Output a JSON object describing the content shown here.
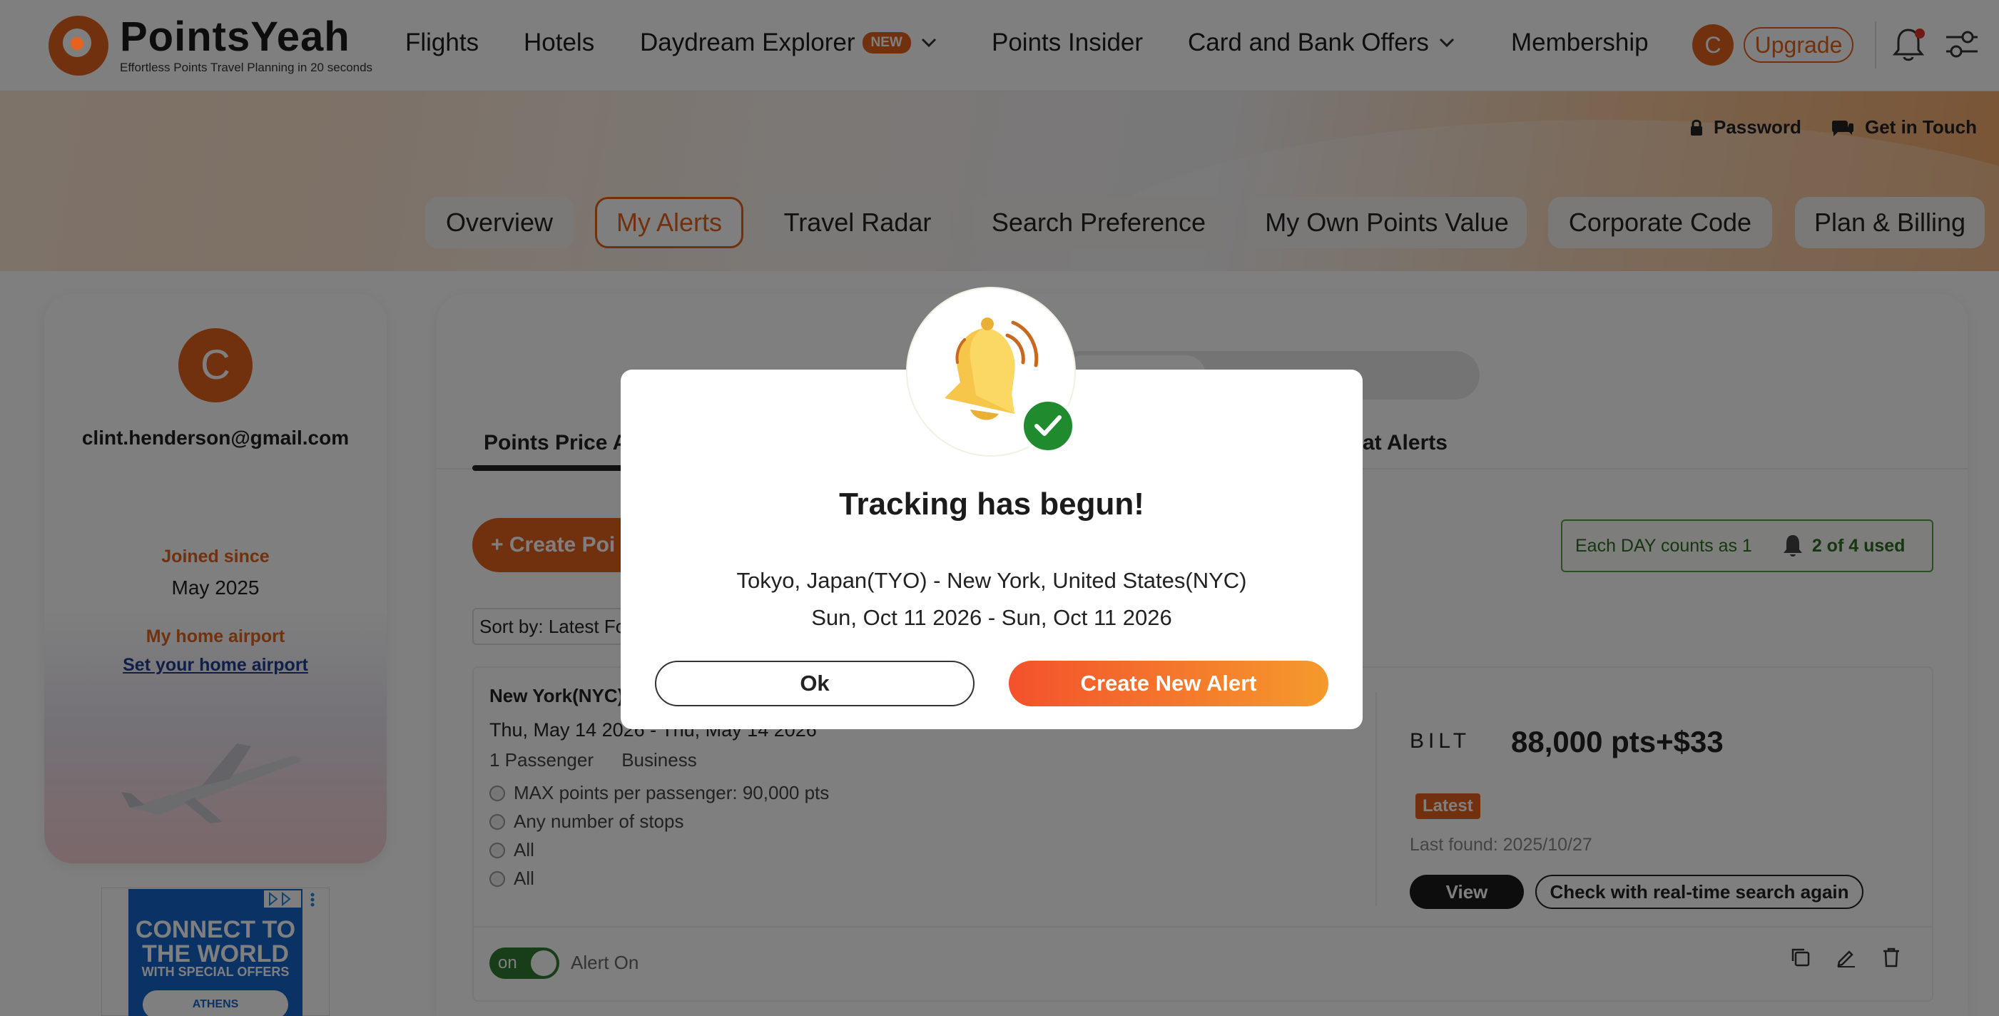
{
  "brand": {
    "name": "PointsYeah",
    "tagline": "Effortless Points Travel Planning in 20 seconds"
  },
  "nav": {
    "items": [
      "Flights",
      "Hotels",
      "Daydream Explorer",
      "Points Insider",
      "Card and Bank Offers",
      "Membership"
    ],
    "new_badge": "NEW",
    "avatar_letter": "C",
    "upgrade": "Upgrade"
  },
  "utility": {
    "password": "Password",
    "contact": "Get in Touch"
  },
  "tabs": [
    "Overview",
    "My Alerts",
    "Travel Radar",
    "Search Preference",
    "My Own Points Value",
    "Corporate Code",
    "Plan & Billing"
  ],
  "profile": {
    "avatar_letter": "C",
    "email": "clint.henderson@gmail.com",
    "joined_label": "Joined since",
    "joined_value": "May 2025",
    "home_label": "My home airport",
    "home_link": "Set your home airport"
  },
  "ad": {
    "title": "CONNECT TO THE WORLD",
    "subtitle": "WITH SPECIAL OFFERS",
    "cta": "ATHENS"
  },
  "alerts": {
    "subtabs": [
      "Points Price A",
      "at Alerts"
    ],
    "create_button": "+ Create Poi",
    "quota_text": "Each DAY counts as 1",
    "quota_used": "2 of 4 used",
    "sort_label": "Sort by: Latest Fo",
    "card": {
      "route": "New York(NYC)",
      "dates": "Thu, May 14 2026 - Thu, May 14 2026",
      "passengers": "1 Passenger",
      "cabin": "Business",
      "criteria": [
        "MAX points per passenger: 90,000 pts",
        "Any number of stops",
        "All",
        "All"
      ],
      "program": "BILT",
      "price": "88,000 pts+$33",
      "latest_badge": "Latest",
      "last_found": "Last found: 2025/10/27",
      "view_button": "View",
      "check_button": "Check with real-time search again",
      "switch_label": "on",
      "alert_status": "Alert On"
    }
  },
  "modal": {
    "title": "Tracking has begun!",
    "route": "Tokyo, Japan(TYO) - New York, United States(NYC)",
    "dates": "Sun, Oct 11 2026 - Sun, Oct 11 2026",
    "ok_button": "Ok",
    "create_button": "Create New Alert"
  },
  "colors": {
    "accent": "#e5631c",
    "success": "#1f8a2e",
    "modal_gradient_start": "#f4512c",
    "modal_gradient_end": "#f59a2c"
  }
}
